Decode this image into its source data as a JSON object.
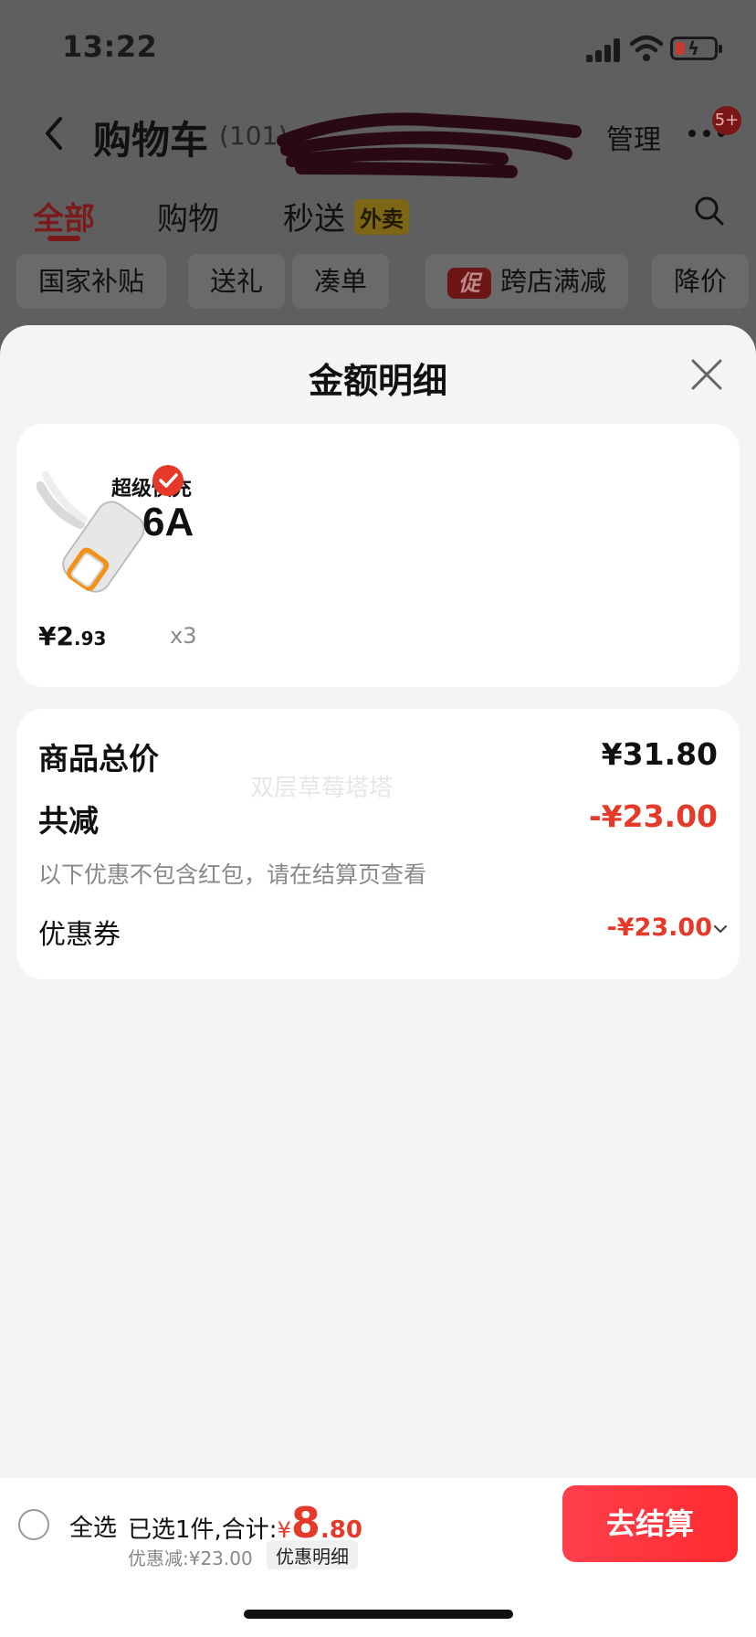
{
  "status_bar": {
    "time": "13:22"
  },
  "nav": {
    "title": "购物车",
    "count": "(101)",
    "manage": "管理",
    "badge": "5+"
  },
  "tabs": [
    {
      "label": "全部",
      "active": true
    },
    {
      "label": "购物"
    },
    {
      "label": "秒送"
    }
  ],
  "tab_badge": "外卖",
  "chips": [
    {
      "label": "国家补贴"
    },
    {
      "label": "送礼"
    },
    {
      "label": "凑单"
    },
    {
      "label": "跨店满减",
      "icon_text": "促"
    },
    {
      "label": "降价"
    }
  ],
  "sheet": {
    "title": "金额明细",
    "product": {
      "image_text_top": "超级快充",
      "image_text_big": "6A",
      "price_currency": "¥",
      "price_int": "2",
      "price_dec": ".93",
      "qty": "x3"
    },
    "detail": {
      "total_label": "商品总价",
      "total_value": "¥31.80",
      "watermark": "双层草莓塔塔",
      "reduce_label": "共减",
      "reduce_value": "-¥23.00",
      "note": "以下优惠不包含红包，请在结算页查看",
      "coupon_label": "优惠券",
      "coupon_value": "-¥23.00"
    }
  },
  "bottom_bar": {
    "select_all": "全选",
    "selected_text": "已选1件,合计:",
    "currency": "¥",
    "amount_int": "8",
    "amount_dec": ".80",
    "discount_text": "优惠减:¥23.00",
    "detail_pill": "优惠明细",
    "checkout": "去结算"
  },
  "colors": {
    "accent_red": "#e53a2a",
    "checkout_red": "#ff3040",
    "sheet_bg": "#f4f4f4"
  }
}
